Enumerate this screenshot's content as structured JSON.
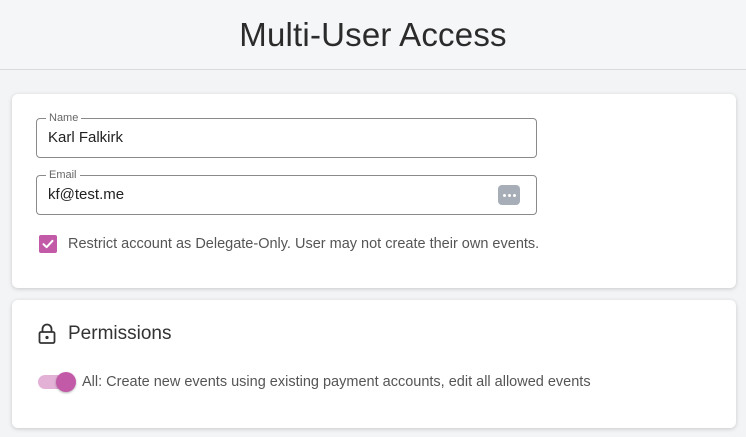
{
  "header": {
    "title": "Multi-User Access"
  },
  "user_form": {
    "name": {
      "label": "Name",
      "value": "Karl Falkirk"
    },
    "email": {
      "label": "Email",
      "value": "kf@test.me",
      "icon": "more-dots-icon"
    },
    "delegate_only": {
      "checked": true,
      "label": "Restrict account as Delegate-Only. User may not create their own events."
    }
  },
  "permissions": {
    "title": "Permissions",
    "icon": "lock-icon",
    "all": {
      "enabled": true,
      "label": "All: Create new events using existing payment accounts, edit all allowed events"
    }
  },
  "colors": {
    "accent": "#c25aa8",
    "accent_light": "#e3b0d6"
  }
}
